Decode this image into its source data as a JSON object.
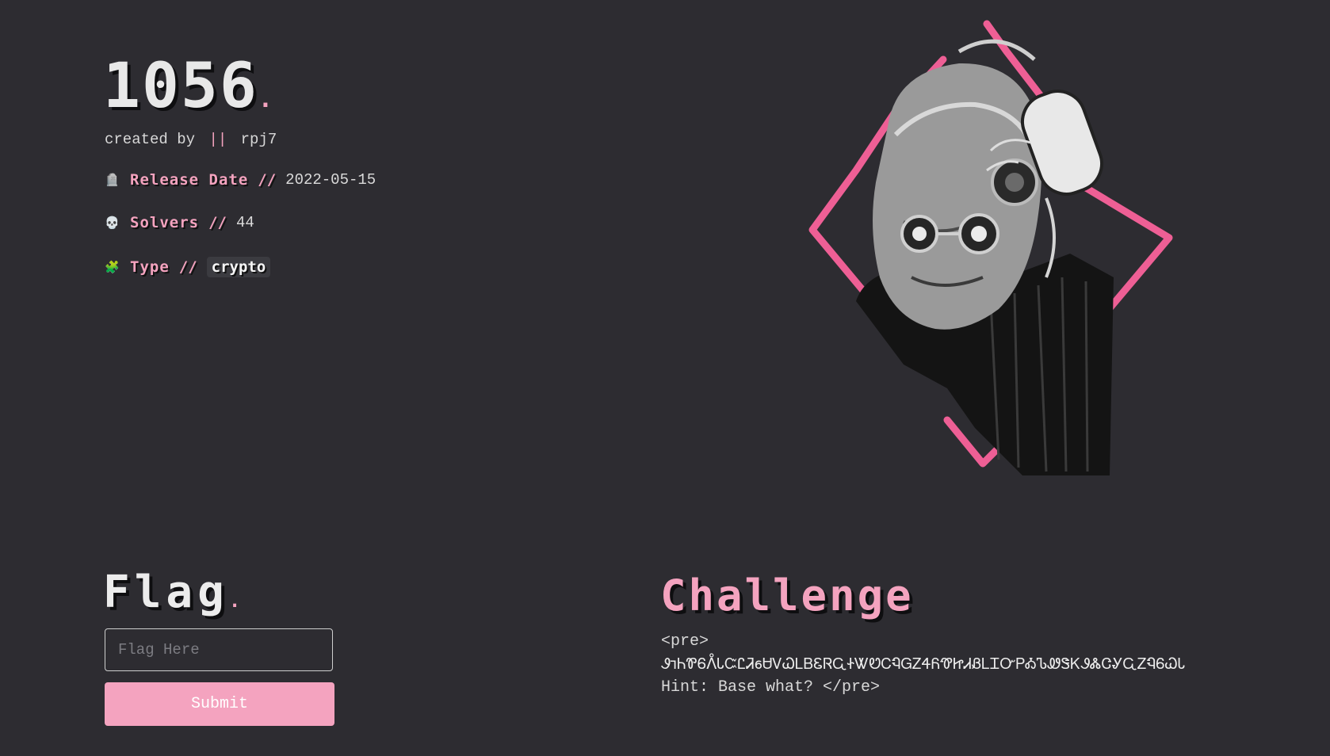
{
  "header": {
    "title": "1056",
    "title_dot": ".",
    "created_by_label": "created by",
    "separator": "||",
    "author": "rpj7"
  },
  "meta": {
    "release": {
      "icon": "tombstone-icon",
      "glyph": "🪦",
      "label": "Release Date",
      "sep": "//",
      "value": "2022-05-15"
    },
    "solvers": {
      "icon": "skull-icon",
      "glyph": "💀",
      "label": "Solvers",
      "sep": "//",
      "value": "44"
    },
    "type": {
      "icon": "puzzle-icon",
      "glyph": "🧩",
      "label": "Type",
      "sep": "//",
      "value": "crypto"
    }
  },
  "flag": {
    "heading": "Flag",
    "heading_dot": ".",
    "input_placeholder": "Flag Here",
    "input_value": "",
    "submit_label": "Submit"
  },
  "challenge": {
    "heading": "Challenge",
    "pre_open": "<pre>",
    "cipher_text": "Ꮽ𐐹ᏂᏈᏮᐰᏓᏨᏝᏘ𐑆ᏌᏙᏇᏞᏴᏋᏒᏩᏐᏔᏬᏟᏄᏀᏃᏎᏲᏡᏥᏗᏰᏞᏆᏅᏢᎣᏖᏪᏕᏦᏭᏜᏣᎽᏩᏃᏄᏮᏇᏓ",
    "hint_line": "Hint: Base what? </pre>"
  },
  "colors": {
    "background": "#2d2c31",
    "accent_pink": "#f4a3bf",
    "text_light": "#e6e6e6"
  },
  "artwork": {
    "name": "cyborg-portrait",
    "frame_color": "#ee5f95"
  }
}
